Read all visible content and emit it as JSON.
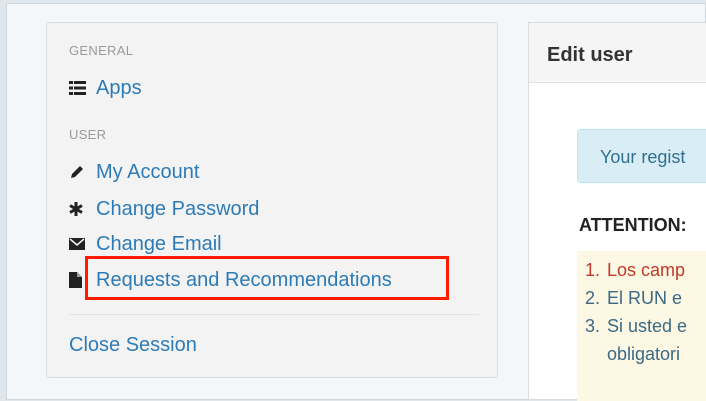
{
  "sidebar": {
    "general_header": "GENERAL",
    "apps_label": "Apps",
    "user_header": "USER",
    "my_account_label": "My Account",
    "change_password_label": "Change Password",
    "change_email_label": "Change Email",
    "requests_label": "Requests and Recommendations",
    "close_session_label": "Close Session"
  },
  "panel": {
    "title": "Edit user",
    "info_text": "Your regist",
    "attention_label": "ATTENTION:",
    "items": [
      {
        "num": "1.",
        "text": "Los camp",
        "color": "#c0392b"
      },
      {
        "num": "2.",
        "text": "El RUN e",
        "color": "#3a6a86"
      },
      {
        "num": "3.",
        "text": "Si usted e",
        "color": "#3a6a86"
      },
      {
        "num": "",
        "text": "obligatori",
        "color": "#3a6a86"
      }
    ]
  },
  "colors": {
    "link": "#2d7bb6",
    "highlight": "#ff1a00",
    "info_bg": "#d9edf7",
    "warning_bg": "#fcf8e3"
  },
  "icons": {
    "apps": "list-icon",
    "my_account": "pencil-icon",
    "change_password": "asterisk-icon",
    "change_email": "envelope-icon",
    "requests": "file-icon"
  }
}
